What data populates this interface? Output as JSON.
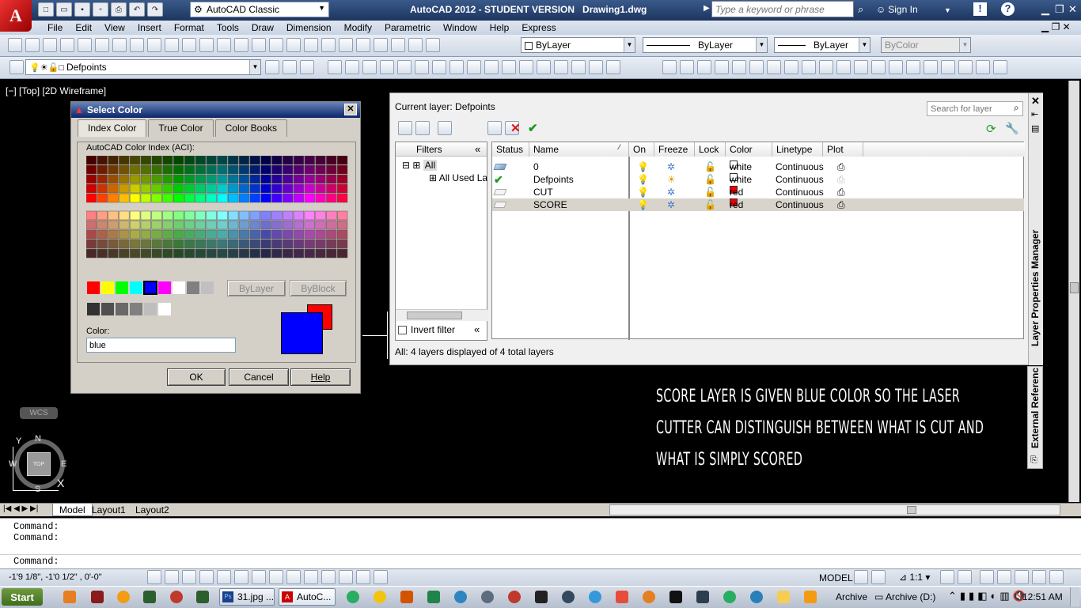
{
  "app": {
    "title": "AutoCAD 2012 - STUDENT VERSION   Drawing1.dwg",
    "workspace": "AutoCAD Classic",
    "search_placeholder": "Type a keyword or phrase",
    "sign_in": "Sign In",
    "logo_letter": "A"
  },
  "menu": [
    "File",
    "Edit",
    "View",
    "Insert",
    "Format",
    "Tools",
    "Draw",
    "Dimension",
    "Modify",
    "Parametric",
    "Window",
    "Help",
    "Express"
  ],
  "toolbar": {
    "color_combo": "ByLayer",
    "linetype_combo": "ByLayer",
    "lineweight_combo": "ByLayer",
    "plotstyle_combo": "ByColor",
    "layer_combo": "Defpoints"
  },
  "viewport_label": "[−] [Top] [2D Wireframe]",
  "select_color": {
    "title": "Select Color",
    "tabs": [
      "Index Color",
      "True Color",
      "Color Books"
    ],
    "aci_label": "AutoCAD Color Index (ACI):",
    "bylayer": "ByLayer",
    "byblock": "ByBlock",
    "color_label": "Color:",
    "color_value": "blue",
    "ok": "OK",
    "cancel": "Cancel",
    "help": "Help",
    "new_color": "#0000ff",
    "old_color": "#ff0000"
  },
  "layer_manager": {
    "current_layer": "Current layer: Defpoints",
    "search_placeholder": "Search for layer",
    "filters_title": "Filters",
    "tree_all": "All",
    "tree_used": "All Used La",
    "invert_filter": "Invert filter",
    "status_text": "All: 4 layers displayed of 4 total layers",
    "side_title": "Layer Properties Manager",
    "side_title2": "External Referenc",
    "columns": [
      "Status",
      "Name",
      "On",
      "Freeze",
      "Lock",
      "Color",
      "Linetype",
      "Plot"
    ],
    "rows": [
      {
        "name": "0",
        "color": "white",
        "color_hex": "#ffffff",
        "linetype": "Continuous",
        "current": false
      },
      {
        "name": "Defpoints",
        "color": "white",
        "color_hex": "#ffffff",
        "linetype": "Continuous",
        "current": true
      },
      {
        "name": "CUT",
        "color": "red",
        "color_hex": "#ee0000",
        "linetype": "Continuous",
        "current": false
      },
      {
        "name": "SCORE",
        "color": "red",
        "color_hex": "#ee0000",
        "linetype": "Continuous",
        "current": false
      }
    ]
  },
  "annotation": [
    "Score layer is given blue color so the laser",
    "cutter can distinguish between what is cut and",
    "what is simply scored"
  ],
  "viewcube": {
    "top": "TOP",
    "n": "N",
    "s": "S",
    "e": "E",
    "w": "W",
    "wcs": "WCS",
    "y": "Y",
    "x": "X"
  },
  "layout_tabs": [
    "Model",
    "Layout1",
    "Layout2"
  ],
  "command_lines": [
    "Command:",
    "Command:",
    "",
    "Command:"
  ],
  "status": {
    "coords": "-1'9 1/8\",  -1'0 1/2\" , 0'-0\"",
    "model": "MODEL",
    "scale": "1:1"
  },
  "taskbar": {
    "start": "Start",
    "tasks": [
      "31.jpg ...",
      "AutoC..."
    ],
    "archive": "Archive",
    "archive_drive": "Archive (D:)",
    "time": "12:51 AM"
  }
}
